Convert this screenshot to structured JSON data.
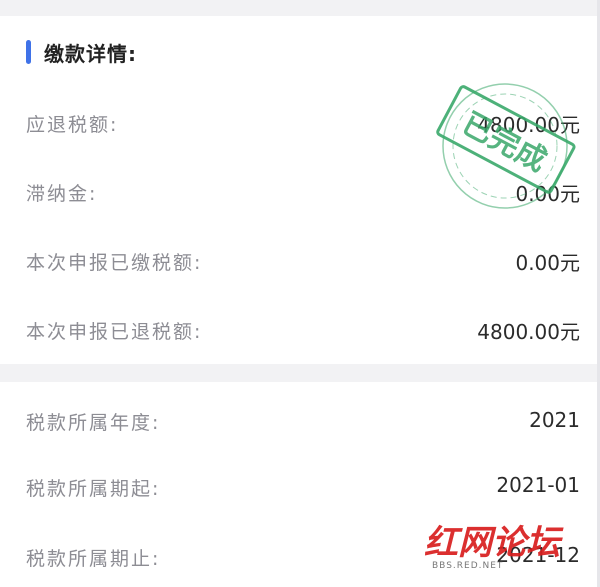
{
  "payment_details": {
    "title": "缴款详情:",
    "rows": [
      {
        "label": "应退税额:",
        "value": "4800.00元"
      },
      {
        "label": "滞纳金:",
        "value": "0.00元"
      },
      {
        "label": "本次申报已缴税额:",
        "value": "0.00元"
      },
      {
        "label": "本次申报已退税额:",
        "value": "4800.00元"
      }
    ],
    "stamp_text": "已完成",
    "stamp_color": "#3aa86a"
  },
  "tax_period": {
    "rows": [
      {
        "label": "税款所属年度:",
        "value": "2021"
      },
      {
        "label": "税款所属期起:",
        "value": "2021-01"
      },
      {
        "label": "税款所属期止:",
        "value": "2021-12"
      }
    ]
  },
  "watermark": {
    "brand": "红网论坛",
    "subtext": "BBS.RED.NET",
    "brand_color": "#d91e1e"
  },
  "colors": {
    "accent": "#3f72e8",
    "label": "#8d8d94",
    "value": "#2b2b2b",
    "background": "#f2f2f4"
  }
}
